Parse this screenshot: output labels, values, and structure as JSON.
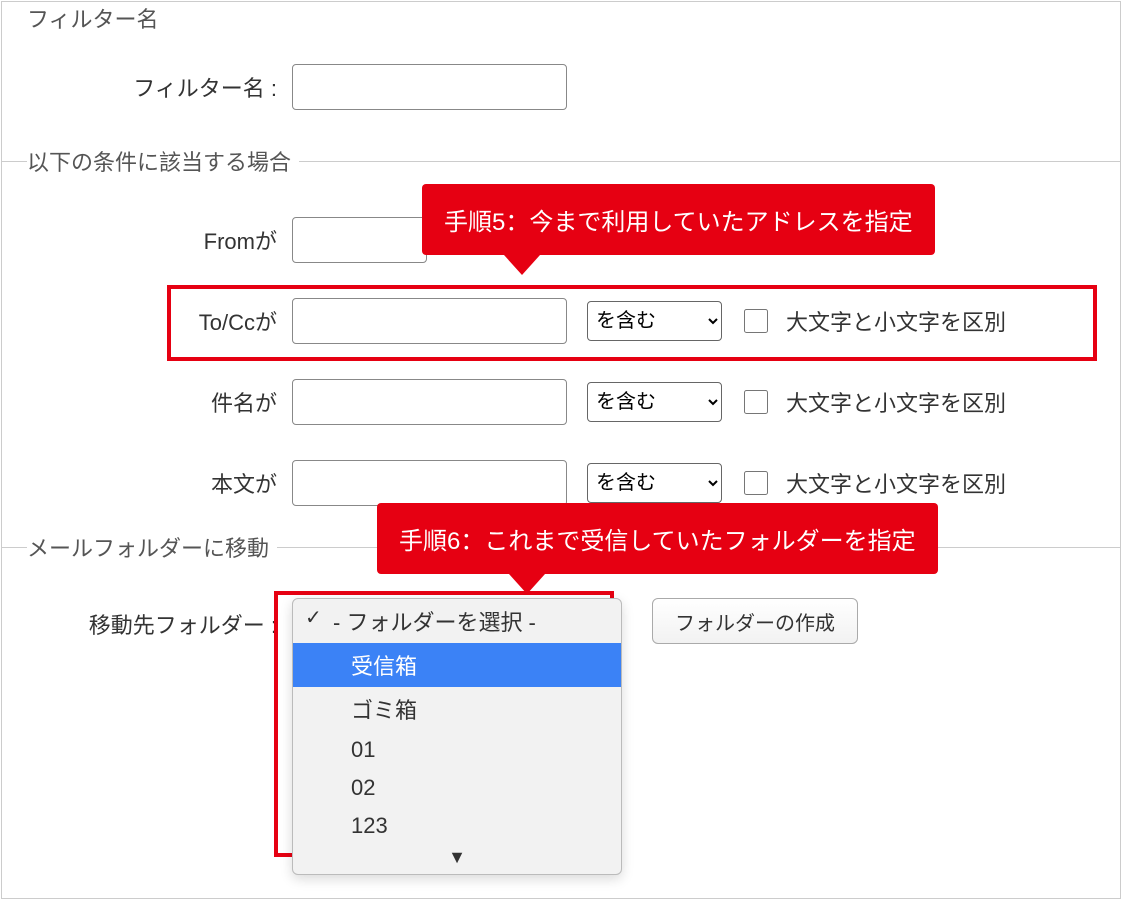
{
  "section1": {
    "legend": "フィルター名",
    "filter_name_label": "フィルター名 :"
  },
  "section2": {
    "legend": "以下の条件に該当する場合",
    "rows": {
      "from": {
        "label": "Fromが"
      },
      "tocc": {
        "label": "To/Ccが",
        "select": "を含む",
        "checkbox_label": "大文字と小文字を区別"
      },
      "subject": {
        "label": "件名が",
        "select": "を含む",
        "checkbox_label": "大文字と小文字を区別"
      },
      "body": {
        "label": "本文が",
        "select": "を含む",
        "checkbox_label": "大文字と小文字を区別"
      }
    }
  },
  "callout5": "手順5：今まで利用していたアドレスを指定",
  "callout6": "手順6：これまで受信していたフォルダーを指定",
  "section3": {
    "legend": "メールフォルダーに移動",
    "dest_label": "移動先フォルダー :",
    "create_button": "フォルダーの作成",
    "dropdown": {
      "placeholder": "- フォルダーを選択 -",
      "items": [
        "受信箱",
        "ゴミ箱",
        "01",
        "02",
        "123"
      ]
    }
  }
}
